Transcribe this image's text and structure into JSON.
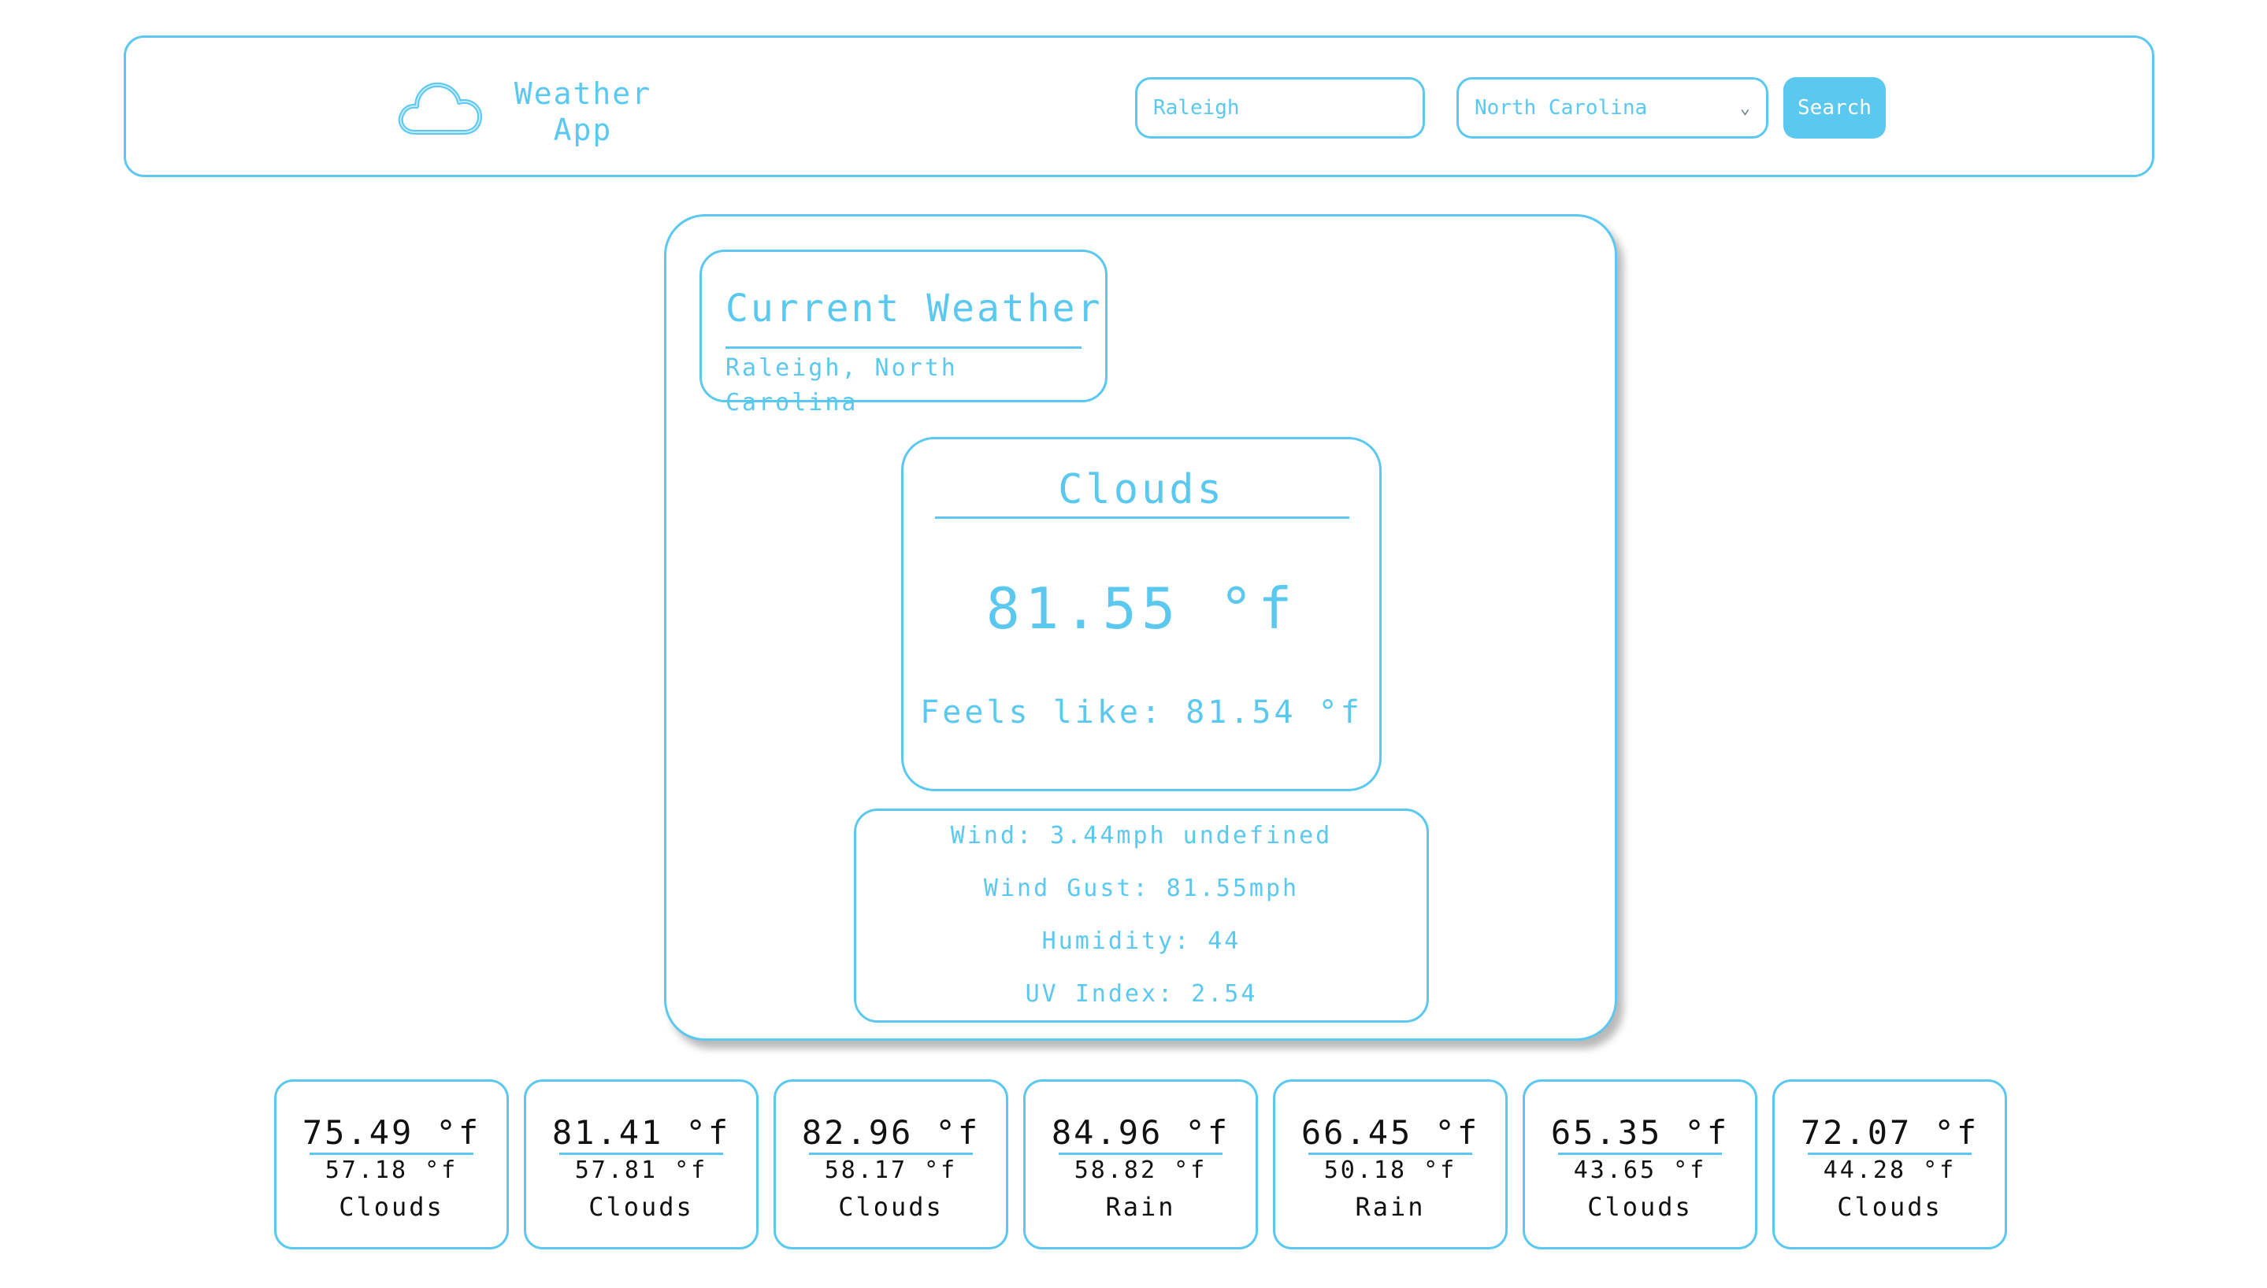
{
  "header": {
    "logo_icon": "cloud-icon",
    "logo_line1": "Weather",
    "logo_line2": "App",
    "city_placeholder": "Raleigh",
    "state_selected": "North Carolina",
    "search_label": "Search"
  },
  "current": {
    "title": "Current Weather",
    "location": "Raleigh, North Carolina",
    "condition": "Clouds",
    "temp": "81.55 °f",
    "feels_like": "Feels like: 81.54 °f",
    "wind": "Wind: 3.44mph undefined",
    "wind_gust": "Wind Gust: 81.55mph",
    "humidity": "Humidity: 44",
    "uv_index": "UV Index: 2.54"
  },
  "forecast": [
    {
      "high": "75.49 °f",
      "low": "57.18 °f",
      "condition": "Clouds"
    },
    {
      "high": "81.41 °f",
      "low": "57.81 °f",
      "condition": "Clouds"
    },
    {
      "high": "82.96 °f",
      "low": "58.17 °f",
      "condition": "Clouds"
    },
    {
      "high": "84.96 °f",
      "low": "58.82 °f",
      "condition": "Rain"
    },
    {
      "high": "66.45 °f",
      "low": "50.18 °f",
      "condition": "Rain"
    },
    {
      "high": "65.35 °f",
      "low": "43.65 °f",
      "condition": "Clouds"
    },
    {
      "high": "72.07 °f",
      "low": "44.28 °f",
      "condition": "Clouds"
    }
  ],
  "colors": {
    "accent": "#5bc8f0",
    "forecast_text": "#111111",
    "background": "#ffffff"
  }
}
